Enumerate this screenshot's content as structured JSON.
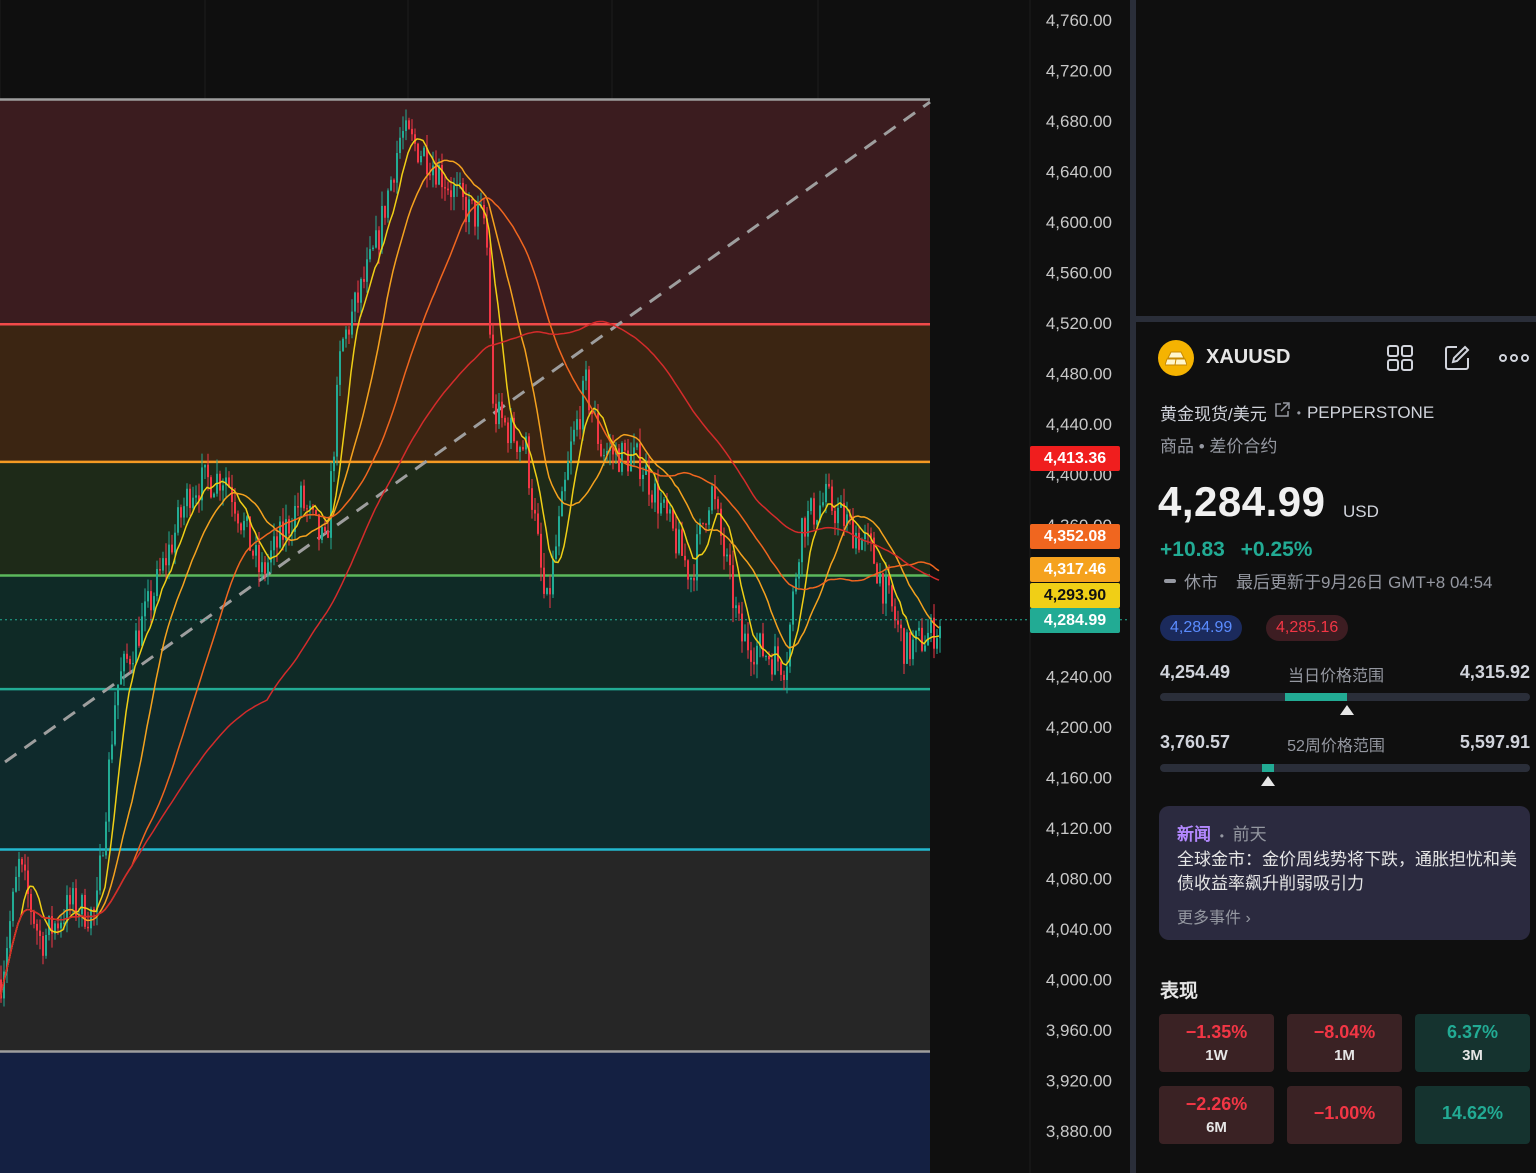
{
  "chart": {
    "y_axis_labels": [
      "4,760.00",
      "4,720.00",
      "4,680.00",
      "4,640.00",
      "4,600.00",
      "4,560.00",
      "4,520.00",
      "4,480.00",
      "4,440.00",
      "4,400.00",
      "4,360.00",
      "4,240.00",
      "4,200.00",
      "4,160.00",
      "4,120.00",
      "4,080.00",
      "4,040.00",
      "4,000.00",
      "3,960.00",
      "3,920.00",
      "3,880.00"
    ],
    "price_tags": [
      {
        "value": "4,413.36",
        "color": "#f01e1e"
      },
      {
        "value": "4,352.08",
        "color": "#f0661f"
      },
      {
        "value": "4,317.46",
        "color": "#f5a21e"
      },
      {
        "value": "4,293.90",
        "color": "#f0cf16"
      },
      {
        "value": "4,284.99",
        "color": "#22ab94"
      }
    ],
    "fib_levels": [
      {
        "price": 4697,
        "line": "#9e9e9e",
        "fill": "#3b1c1f"
      },
      {
        "price": 4519,
        "line": "#f24a4a",
        "fill": "#3b2512"
      },
      {
        "price": 4410,
        "line": "#f59a23",
        "fill": "#1e2a18"
      },
      {
        "price": 4320,
        "line": "#5cb85c",
        "fill": "#0f2a26"
      },
      {
        "price": 4230,
        "line": "#22ab94",
        "fill": "#0f2a2c"
      },
      {
        "price": 4103,
        "line": "#22b8cf",
        "fill": "#262626"
      },
      {
        "price": 3943,
        "line": "#9e9e9e",
        "fill": "#142042"
      }
    ]
  },
  "panel": {
    "symbol": "XAUUSD",
    "description": "黄金现货/美元",
    "broker": "PEPPERSTONE",
    "category": "商品 • 差价合约",
    "price": "4,284.99",
    "currency": "USD",
    "change_abs": "+10.83",
    "change_pct": "+0.25%",
    "market_status": "休市",
    "last_update": "最后更新于9月26日 GMT+8 04:54",
    "bid": "4,284.99",
    "ask": "4,285.16",
    "day_range": {
      "low": "4,254.49",
      "label": "当日价格范围",
      "high": "4,315.92",
      "position": 0.5
    },
    "week52_range": {
      "low": "3,760.57",
      "label": "52周价格范围",
      "high": "5,597.91",
      "position": 0.28
    },
    "news": {
      "tag": "新闻",
      "time": "前天",
      "headline": "全球金市：金价周线势将下跌，通胀担忧和美债收益率飙升削弱吸引力",
      "more": "更多事件"
    },
    "performance_title": "表现",
    "performance": [
      {
        "value": "−1.35%",
        "period": "1W",
        "dir": "neg"
      },
      {
        "value": "−8.04%",
        "period": "1M",
        "dir": "neg"
      },
      {
        "value": "6.37%",
        "period": "3M",
        "dir": "pos"
      },
      {
        "value": "−2.26%",
        "period": "6M",
        "dir": "neg"
      },
      {
        "value": "−1.00%",
        "period": "",
        "dir": "neg"
      },
      {
        "value": "14.62%",
        "period": "",
        "dir": "pos"
      }
    ]
  }
}
